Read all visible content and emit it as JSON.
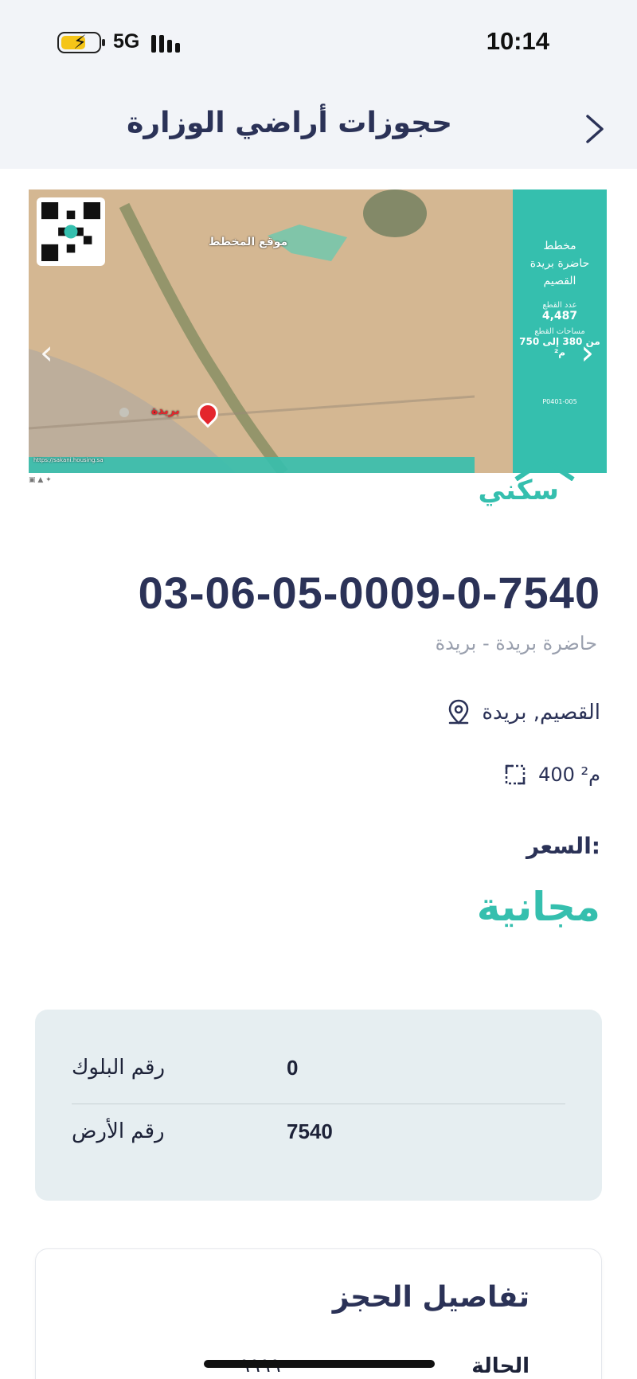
{
  "status_bar": {
    "time": "10:14",
    "network": "5G"
  },
  "header": {
    "title": "حجوزات أراضي الوزارة",
    "back_icon": "chevron-right-icon"
  },
  "map_banner": {
    "panel_title_1": "مخطط",
    "panel_title_2": "حاضرة بريدة",
    "panel_title_3": "القصيم",
    "plots_label": "عدد القطع",
    "plots_count": "4,487",
    "areas_label": "مساحات القطع",
    "areas_value": "من 380 إلى 750 م²",
    "plan_code": "P0401-005",
    "plan_location_label": "موقع المخطط",
    "city_label": "بريدة",
    "url": "https://sakani.housing.sa"
  },
  "brand": {
    "logo_text": "سكني"
  },
  "land": {
    "id": "03-06-05-0009-0-7540",
    "subtitle": "حاضرة بريدة - بريدة",
    "location": "القصيم, بريدة",
    "area": "400 م²",
    "price_label": "السعر:",
    "price_value": "مجانية"
  },
  "info_card": {
    "rows": [
      {
        "label": "رقم البلوك",
        "value": "0"
      },
      {
        "label": "رقم الأرض",
        "value": "7540"
      }
    ]
  },
  "booking": {
    "title": "تفاصيل الحجز",
    "status_label": "الحالة",
    "status_value": "٩٩٩٩"
  },
  "colors": {
    "accent": "#35bfae",
    "text_dark": "#2b3257",
    "card_bg": "#e6eef1"
  }
}
